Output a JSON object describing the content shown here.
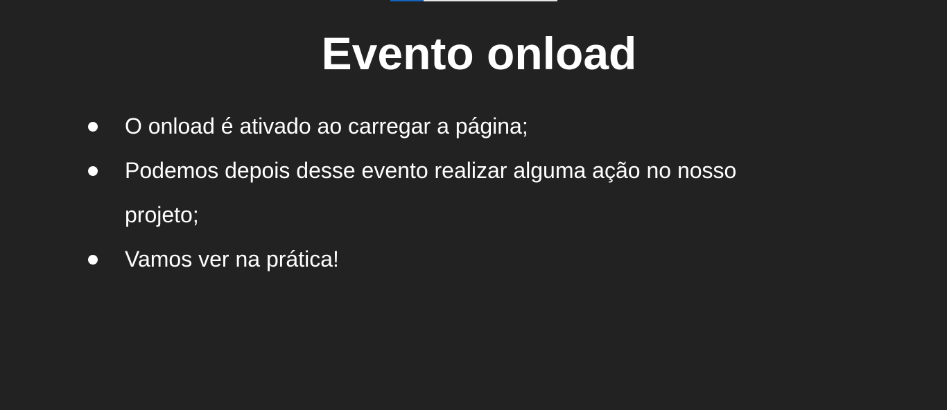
{
  "slide": {
    "title": "Evento onload",
    "bullets": [
      "O onload é ativado ao carregar a página;",
      "Podemos depois desse evento realizar alguma ação no nosso projeto;",
      "Vamos ver na prática!"
    ]
  },
  "colors": {
    "background": "#222222",
    "text": "#ffffff",
    "indicator_accent": "#1565c0",
    "indicator_track": "#e6e6e6"
  }
}
